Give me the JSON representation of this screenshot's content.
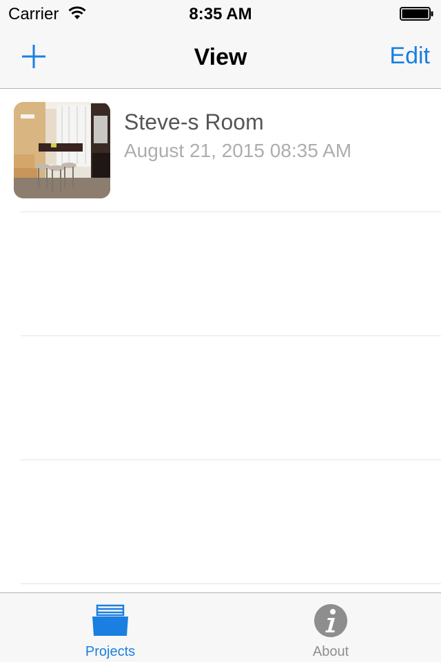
{
  "status_bar": {
    "carrier": "Carrier",
    "time": "8:35 AM",
    "wifi_icon": "wifi-icon",
    "battery_icon": "battery-full-icon"
  },
  "nav_bar": {
    "title": "View",
    "add_icon": "plus-icon",
    "edit_label": "Edit"
  },
  "projects": [
    {
      "title": "Steve-s Room",
      "date": "August 21, 2015 08:35 AM",
      "thumbnail": "room-photo"
    }
  ],
  "tab_bar": {
    "tabs": [
      {
        "label": "Projects",
        "icon": "projects-box-icon",
        "selected": true
      },
      {
        "label": "About",
        "icon": "info-icon",
        "selected": false
      }
    ]
  },
  "colors": {
    "accent": "#1a7fe0",
    "tab_active": "#1a7fe0",
    "tab_inactive": "#8e8e8e",
    "bar_background": "#f7f7f7",
    "title_text": "#555555",
    "subtitle_text": "#adadad"
  }
}
